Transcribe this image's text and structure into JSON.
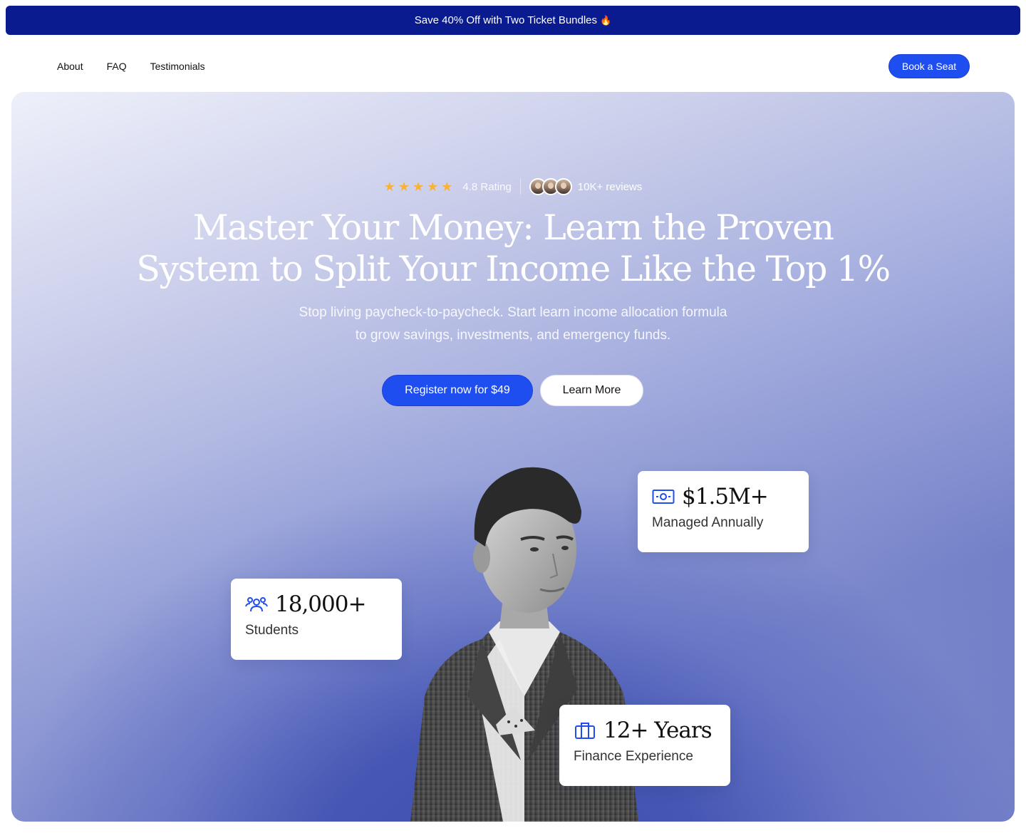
{
  "promo": {
    "text": "Save 40% Off with Two Ticket Bundles",
    "emoji": "🔥"
  },
  "nav": {
    "links": [
      "About",
      "FAQ",
      "Testimonials"
    ],
    "cta": "Book a Seat"
  },
  "hero": {
    "stars": "★★★★★",
    "rating": "4.8 Rating",
    "reviews": "10K+ reviews",
    "headline_line1": "Master Your Money: Learn the Proven",
    "headline_line2": "System to Split Your Income Like the Top 1%",
    "sub_line1": "Stop living paycheck-to-paycheck. Start learn income allocation formula",
    "sub_line2": "to grow savings, investments, and emergency funds.",
    "primary_cta": "Register now for $49",
    "secondary_cta": "Learn More"
  },
  "stats": {
    "managed": {
      "value": "$1.5M+",
      "label": "Managed Annually",
      "icon": "money-icon"
    },
    "students": {
      "value": "18,000+",
      "label": "Students",
      "icon": "users-icon"
    },
    "years": {
      "value": "12+ Years",
      "label": "Finance Experience",
      "icon": "briefcase-icon"
    }
  },
  "colors": {
    "promo_bg": "#0a1a8f",
    "accent": "#1f4ef0",
    "star": "#f7b23b",
    "icon": "#1f4ef0"
  }
}
